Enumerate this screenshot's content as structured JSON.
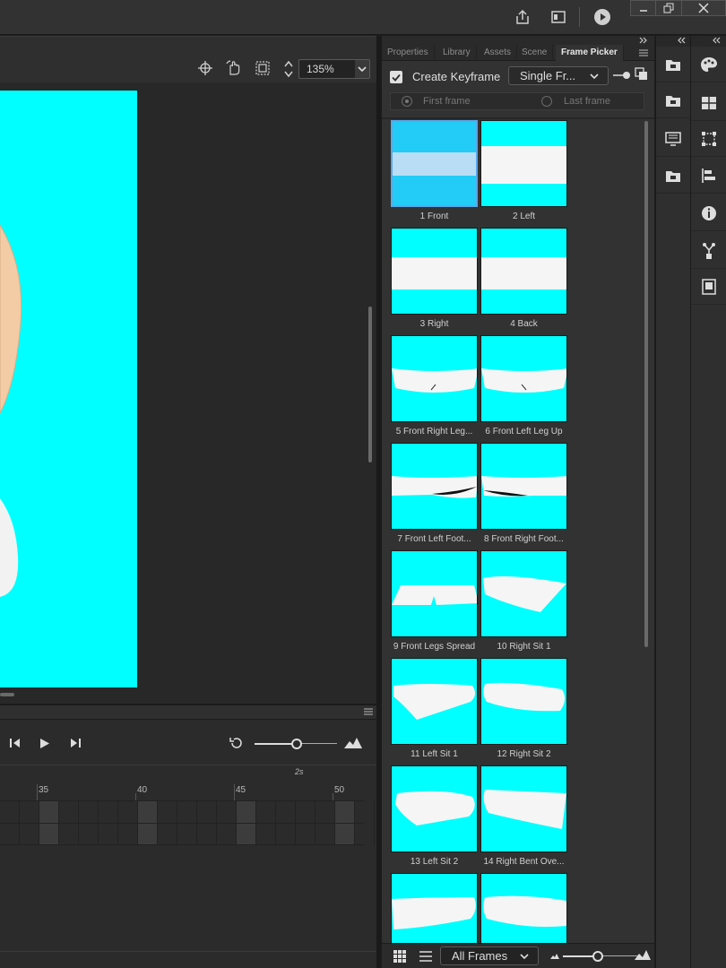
{
  "stage": {
    "zoom": "135%"
  },
  "timeline": {
    "ruler_numbers": [
      "35",
      "40",
      "45",
      "50"
    ],
    "ruler_seconds": "2s"
  },
  "panel": {
    "tabs": [
      "Properties",
      "Library",
      "Assets",
      "Scene",
      "Frame Picker"
    ],
    "active_tab": "Frame Picker",
    "create_keyframe_label": "Create Keyframe",
    "create_keyframe_checked": true,
    "mode_selected": "Single Fr...",
    "first_frame_label": "First frame",
    "last_frame_label": "Last frame",
    "filter_selected": "All Frames",
    "frames": [
      {
        "label": "1 Front",
        "selected": true
      },
      {
        "label": "2 Left"
      },
      {
        "label": "3 Right"
      },
      {
        "label": "4 Back"
      },
      {
        "label": "5 Front Right Leg..."
      },
      {
        "label": "6 Front Left Leg Up"
      },
      {
        "label": "7 Front Left Foot..."
      },
      {
        "label": "8 Front Right Foot..."
      },
      {
        "label": "9 Front Legs Spread"
      },
      {
        "label": "10 Right Sit 1"
      },
      {
        "label": "11 Left Sit 1"
      },
      {
        "label": "12 Right Sit 2"
      },
      {
        "label": "13 Left Sit 2"
      },
      {
        "label": "14 Right Bent Ove..."
      },
      {
        "label": ""
      },
      {
        "label": ""
      }
    ]
  },
  "colors": {
    "canvas": "#00ffff",
    "accent": "#5aa7e8",
    "panel_bg": "#323232"
  }
}
